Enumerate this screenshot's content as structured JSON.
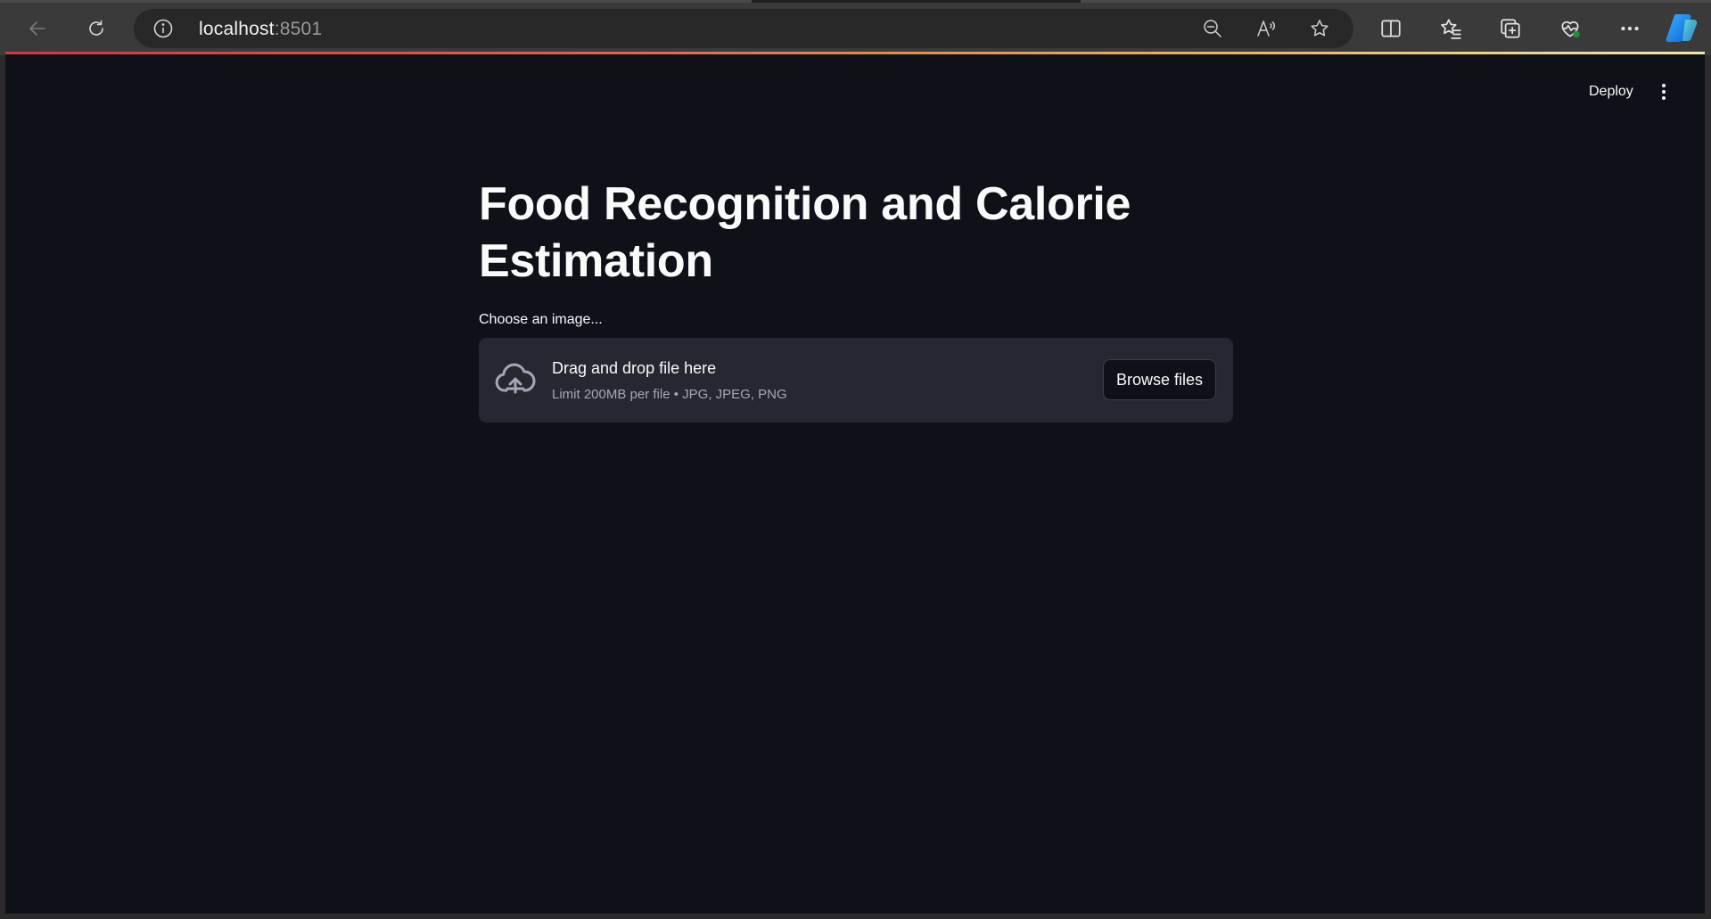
{
  "browser": {
    "url_host": "localhost",
    "url_port": ":8501",
    "icons": {
      "back": "back-arrow-icon",
      "refresh": "refresh-icon",
      "site_info": "info-icon",
      "zoom": "zoom-out-icon",
      "read_aloud": "read-aloud-icon",
      "favorite": "star-icon",
      "split_screen": "split-screen-icon",
      "favorites": "favorites-icon",
      "collections": "collections-icon",
      "health": "browser-essentials-icon",
      "more": "more-icon",
      "copilot": "copilot-icon"
    }
  },
  "app": {
    "deploy_label": "Deploy",
    "title": "Food Recognition and Calorie Estimation",
    "uploader": {
      "label": "Choose an image...",
      "drag_text": "Drag and drop file here",
      "limit_text": "Limit 200MB per file • JPG, JPEG, PNG",
      "browse_label": "Browse files"
    }
  },
  "colors": {
    "app_background": "#0e1117",
    "dropzone_background": "#262730",
    "text": "#fafafa",
    "muted_text": "#a3a8b8"
  }
}
